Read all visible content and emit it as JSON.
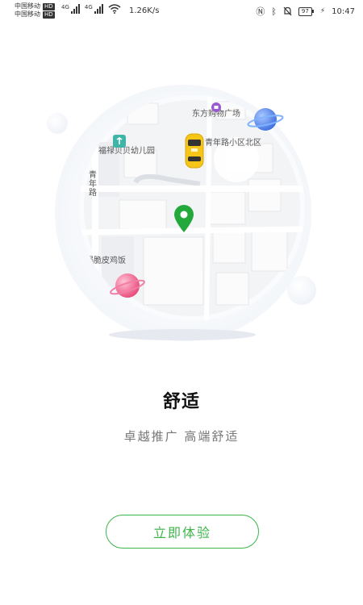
{
  "status_bar": {
    "carrier1": "中国移动",
    "carrier2": "中国移动",
    "hd1": "HD",
    "hd2": "HD",
    "net1": "4G",
    "net2": "4G",
    "speed": "1.26K/s",
    "battery": "97",
    "time": "10:47"
  },
  "map": {
    "labels": {
      "mall": "东方购物广场",
      "kindergarten": "福禄贝贝幼儿园",
      "community": "青年路小区北区",
      "road": "青年路",
      "restaurant": "锅脆皮鸡饭"
    }
  },
  "onboarding": {
    "title": "舒适",
    "subtitle": "卓越推广 高端舒适",
    "cta_label": "立即体验"
  },
  "colors": {
    "accent": "#3cb44a",
    "pin": "#23a83c",
    "taxi": "#f5c518"
  }
}
